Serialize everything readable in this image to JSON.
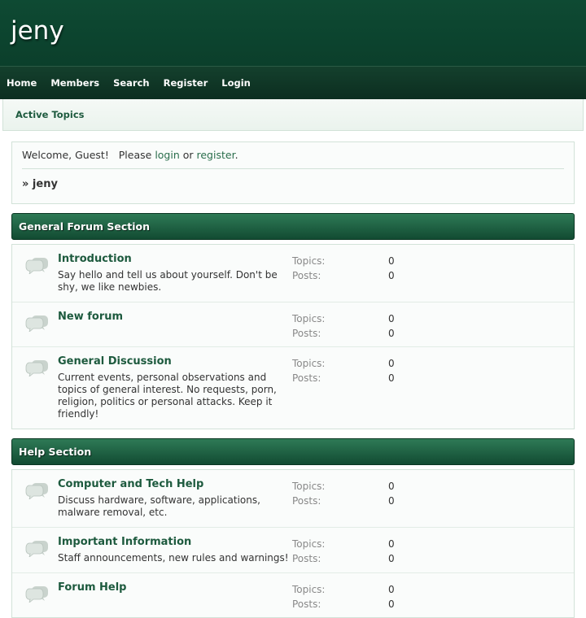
{
  "header": {
    "title": "jeny"
  },
  "nav": [
    {
      "label": "Home"
    },
    {
      "label": "Members"
    },
    {
      "label": "Search"
    },
    {
      "label": "Register"
    },
    {
      "label": "Login"
    }
  ],
  "subnav": {
    "active_topics": "Active Topics"
  },
  "welcome": {
    "prefix": "Welcome, Guest!   Please ",
    "login": "login",
    "or": " or ",
    "register": "register",
    "period": ".",
    "breadcrumb": "» jeny"
  },
  "sections": [
    {
      "title": "General Forum Section",
      "forums": [
        {
          "name": "Introduction",
          "description": "Say hello and tell us about yourself. Don't be shy, we like newbies.",
          "topics_label": "Topics:",
          "topics": "0",
          "posts_label": "Posts:",
          "posts": "0"
        },
        {
          "name": "New forum",
          "description": "",
          "topics_label": "Topics:",
          "topics": "0",
          "posts_label": "Posts:",
          "posts": "0"
        },
        {
          "name": "General Discussion",
          "description": "Current events, personal observations and topics of general interest. No requests, porn, religion, politics or personal attacks. Keep it friendly!",
          "topics_label": "Topics:",
          "topics": "0",
          "posts_label": "Posts:",
          "posts": "0"
        }
      ]
    },
    {
      "title": "Help Section",
      "forums": [
        {
          "name": "Computer and Tech Help",
          "description": "Discuss hardware, software, applications, malware removal, etc.",
          "topics_label": "Topics:",
          "topics": "0",
          "posts_label": "Posts:",
          "posts": "0"
        },
        {
          "name": "Important Information",
          "description": "Staff announcements, new rules and warnings!",
          "topics_label": "Topics:",
          "topics": "0",
          "posts_label": "Posts:",
          "posts": "0"
        },
        {
          "name": "Forum Help",
          "description": "",
          "topics_label": "Topics:",
          "topics": "0",
          "posts_label": "Posts:",
          "posts": "0"
        }
      ]
    }
  ],
  "icons": {
    "forum": "speech-bubbles-icon"
  },
  "colors": {
    "header": "#0e4a33",
    "accent": "#1d5a3e"
  }
}
